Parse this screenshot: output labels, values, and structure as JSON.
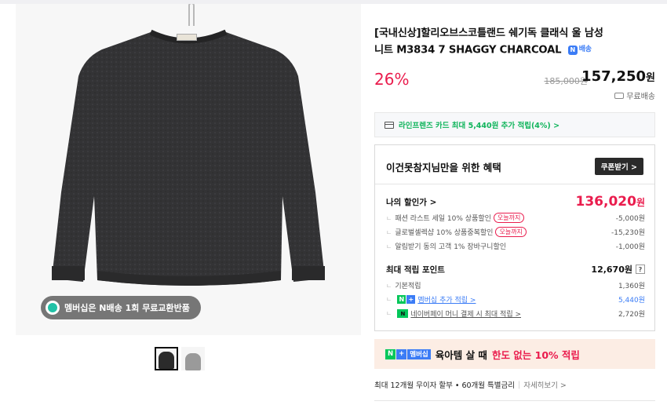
{
  "product": {
    "title_line1": "[국내신상]할리오브스코틀랜드 쉐기독 클래식 울 남성",
    "title_line2": "니트 M3834 7 SHAGGY CHARCOAL",
    "npay_badge_label": "배송",
    "discount_rate": "26%",
    "original_price": "185,000원",
    "final_price": "157,250",
    "currency": "원",
    "shipping": "무료배송"
  },
  "image": {
    "membership_text": "멤버십은 N배송 1회 무료교환반품",
    "thumbnails": [
      {
        "color": "#2b2b2b",
        "selected": true
      },
      {
        "color": "#9a9a9a",
        "selected": false
      }
    ]
  },
  "card_offer": {
    "text": "라인프렌즈 카드 최대 5,440원 추가 적립(4%) >"
  },
  "benefits": {
    "title": "이건못참지님만을 위한 혜택",
    "coupon_button": "쿠폰받기 >",
    "my_discount_label": "나의 할인가 >",
    "my_discount_price": "136,020",
    "currency": "원",
    "discount_items": [
      {
        "label": "패션 라스트 세일 10% 상품할인",
        "tag": "오늘까지",
        "amount": "-5,000원"
      },
      {
        "label": "글로벌셀렉샵 10% 상품중복할인",
        "tag": "오늘까지",
        "amount": "-15,230원"
      },
      {
        "label": "알림받기 동의 고객 1% 장바구니할인",
        "tag": "",
        "amount": "-1,000원"
      }
    ],
    "points_label": "최대 적립 포인트",
    "points_total": "12,670원",
    "points_help": "?",
    "points_items": [
      {
        "label": "기본적립",
        "amount": "1,360원"
      },
      {
        "label": "멤버십 추가 적립 >",
        "amount": "5,440원"
      },
      {
        "label": "네이버페이 머니 결제 시 최대 적립 >",
        "amount": "2,720원"
      }
    ]
  },
  "promo": {
    "tag_n": "N",
    "tag_plus": "+",
    "tag_membership": "멤버십",
    "text": "육아템 살 때",
    "highlight": "한도 없는 10% 적립"
  },
  "installment": {
    "text": "최대 12개월 무이자 할부 • 60개월 특별금리",
    "more": "자세히보기 >"
  },
  "colors": {
    "accent_red": "#ea1c4d",
    "naver_green": "#03c75a",
    "naver_blue": "#3b7cf6",
    "sweater": "#2f2f30"
  }
}
